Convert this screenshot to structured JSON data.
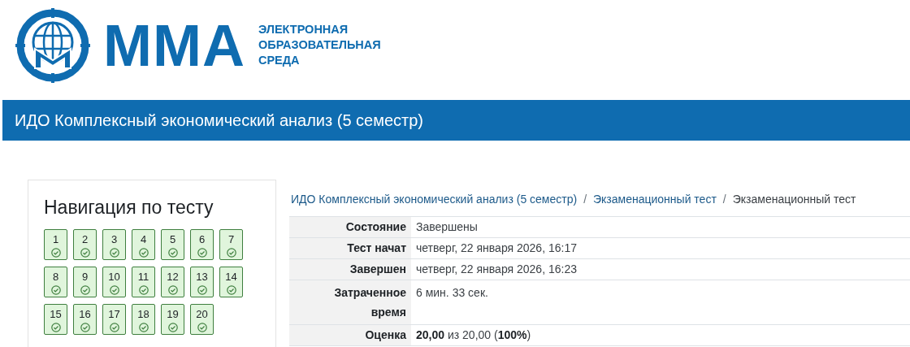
{
  "logo": {
    "mark": "ММА",
    "caption": [
      "ЭЛЕКТРОННАЯ",
      "ОБРАЗОВАТЕЛЬНАЯ",
      "СРЕДА"
    ]
  },
  "course_bar": {
    "title": "ИДО Комплексный экономический анализ (5 семестр)"
  },
  "quiz_navigation": {
    "title": "Навигация по тесту",
    "questions": [
      {
        "label": "1",
        "answered": true
      },
      {
        "label": "2",
        "answered": true
      },
      {
        "label": "3",
        "answered": true
      },
      {
        "label": "4",
        "answered": true
      },
      {
        "label": "5",
        "answered": true
      },
      {
        "label": "6",
        "answered": true
      },
      {
        "label": "7",
        "answered": true
      },
      {
        "label": "8",
        "answered": true
      },
      {
        "label": "9",
        "answered": true
      },
      {
        "label": "10",
        "answered": true
      },
      {
        "label": "11",
        "answered": true
      },
      {
        "label": "12",
        "answered": true
      },
      {
        "label": "13",
        "answered": true
      },
      {
        "label": "14",
        "answered": true
      },
      {
        "label": "15",
        "answered": true
      },
      {
        "label": "16",
        "answered": true
      },
      {
        "label": "17",
        "answered": true
      },
      {
        "label": "18",
        "answered": true
      },
      {
        "label": "19",
        "answered": true
      },
      {
        "label": "20",
        "answered": true
      }
    ]
  },
  "breadcrumb": [
    {
      "label": "ИДО Комплексный экономический анализ (5 семестр)",
      "link": true
    },
    {
      "separator": "/",
      "label": "Экзаменационный тест",
      "link": true
    },
    {
      "separator": "/",
      "label": "Экзаменационный тест",
      "link": false
    }
  ],
  "summary": [
    {
      "label": "Состояние",
      "value": "Завершены"
    },
    {
      "label": "Тест начат",
      "value": "четверг, 22 января 2026, 16:17"
    },
    {
      "label": "Завершен",
      "value": "четверг, 22 января 2026, 16:23"
    },
    {
      "label": "Затраченное время",
      "value": "6 мин. 33 сек."
    },
    {
      "label": "Оценка",
      "value": "**20,00** из 20,00 (**100%**)"
    }
  ]
}
